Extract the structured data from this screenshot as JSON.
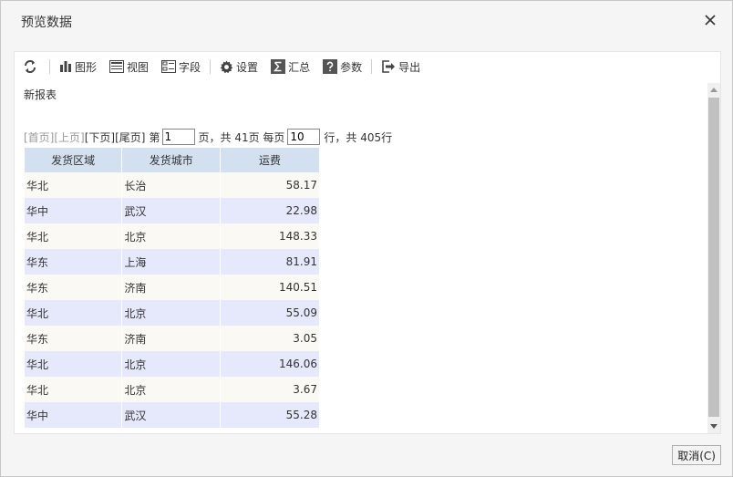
{
  "dialog": {
    "title": "预览数据",
    "cancel_label": "取消(C)"
  },
  "toolbar": {
    "chart": "图形",
    "view": "视图",
    "field": "字段",
    "settings": "设置",
    "summary": "汇总",
    "params": "参数",
    "export": "导出"
  },
  "report": {
    "title": "新报表"
  },
  "pager": {
    "first": "[首页]",
    "prev": "[上页]",
    "next": "[下页]",
    "last": "[尾页]",
    "page_prefix": "第",
    "page_value": "1",
    "page_suffix": "页，共 41页 每页",
    "size_value": "10",
    "size_suffix": "行，共 405行"
  },
  "table": {
    "headers": [
      "发货区域",
      "发货城市",
      "运费"
    ],
    "rows": [
      [
        "华北",
        "长治",
        "58.17"
      ],
      [
        "华中",
        "武汉",
        "22.98"
      ],
      [
        "华北",
        "北京",
        "148.33"
      ],
      [
        "华东",
        "上海",
        "81.91"
      ],
      [
        "华东",
        "济南",
        "140.51"
      ],
      [
        "华北",
        "北京",
        "55.09"
      ],
      [
        "华东",
        "济南",
        "3.05"
      ],
      [
        "华北",
        "北京",
        "146.06"
      ],
      [
        "华北",
        "北京",
        "3.67"
      ],
      [
        "华中",
        "武汉",
        "55.28"
      ]
    ]
  }
}
